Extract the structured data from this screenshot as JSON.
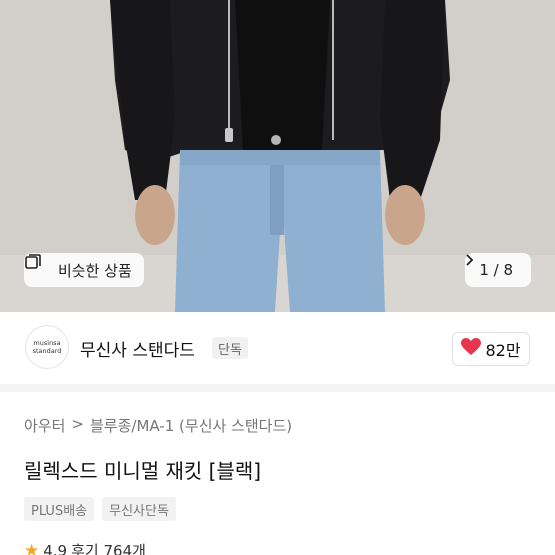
{
  "product_image": {
    "similar_button_label": "비슷한 상품",
    "counter_text": "1 / 8"
  },
  "brand": {
    "logo_line1": "musinsa",
    "logo_line2": "standard",
    "name": "무신사 스탠다드",
    "tag": "단독",
    "likes": "82만"
  },
  "breadcrumb": {
    "item1": "아우터",
    "separator": ">",
    "item2": "블루종/MA-1 (무신사 스탠다드)"
  },
  "product": {
    "title": "릴렉스드 미니멀 재킷 [블랙]",
    "tags": [
      "PLUS배송",
      "무신사단독"
    ],
    "rating": "4.9",
    "review_label": "후기 764개"
  },
  "colors": {
    "heart": "#e8344e",
    "star": "#f5a623",
    "jacket": "#1c1c1e",
    "jeans": "#8fb0d0"
  }
}
